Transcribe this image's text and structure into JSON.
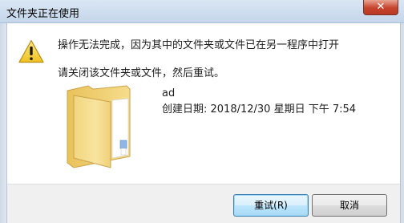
{
  "dialog": {
    "title": "文件夹正在使用",
    "close_symbol": "✕",
    "main_message": "操作无法完成，因为其中的文件夹或文件已在另一程序中打开",
    "sub_message": "请关闭该文件夹或文件，然后重试。"
  },
  "file": {
    "name": "ad",
    "created": "创建日期: 2018/12/30 星期日 下午 7:54"
  },
  "buttons": {
    "retry_label": "重试(R)",
    "cancel_label": "取消"
  },
  "icons": {
    "warning": "warning-icon",
    "folder": "folder-icon",
    "close": "close-icon"
  },
  "colors": {
    "title_bar": "#c5d6ea",
    "close_button": "#c7432b",
    "warning_yellow": "#f5d33b",
    "folder_yellow": "#f4d27a",
    "default_button_border": "#3c7fb1"
  }
}
